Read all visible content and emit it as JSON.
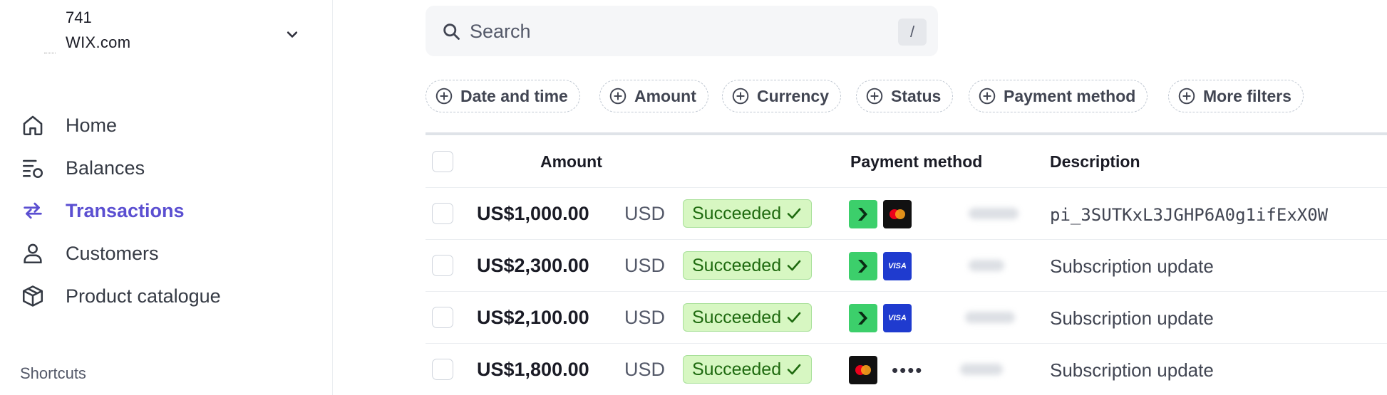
{
  "account": {
    "line1": "741",
    "line2": "WIX.com"
  },
  "nav": [
    {
      "label": "Home",
      "icon": "home-icon"
    },
    {
      "label": "Balances",
      "icon": "balances-icon"
    },
    {
      "label": "Transactions",
      "icon": "transactions-icon",
      "active": true
    },
    {
      "label": "Customers",
      "icon": "customer-icon"
    },
    {
      "label": "Product catalogue",
      "icon": "product-box-icon"
    }
  ],
  "shortcuts_label": "Shortcuts",
  "search": {
    "placeholder": "Search",
    "shortcut": "/"
  },
  "filters": [
    "Date and time",
    "Amount",
    "Currency",
    "Status",
    "Payment method",
    "More filters"
  ],
  "table": {
    "headers": {
      "amount": "Amount",
      "payment_method": "Payment method",
      "description": "Description"
    },
    "rows": [
      {
        "amount": "US$1,000.00",
        "currency": "USD",
        "status": "Succeeded",
        "payment": [
          "link",
          "mastercard"
        ],
        "description": "pi_3SUTKxL3JGHP6A0g1ifExX0W"
      },
      {
        "amount": "US$2,300.00",
        "currency": "USD",
        "status": "Succeeded",
        "payment": [
          "link",
          "visa"
        ],
        "description": "Subscription update"
      },
      {
        "amount": "US$2,100.00",
        "currency": "USD",
        "status": "Succeeded",
        "payment": [
          "link",
          "visa"
        ],
        "description": "Subscription update"
      },
      {
        "amount": "US$1,800.00",
        "currency": "USD",
        "status": "Succeeded",
        "payment": [
          "mastercard"
        ],
        "card_mask": "••••",
        "description": "Subscription update"
      }
    ]
  },
  "colors": {
    "accent": "#5b4fd1",
    "success_bg": "#d7f7c2",
    "success_text": "#1e6a0f",
    "link_green": "#3ccf6b",
    "visa_blue": "#1f3bcf"
  }
}
